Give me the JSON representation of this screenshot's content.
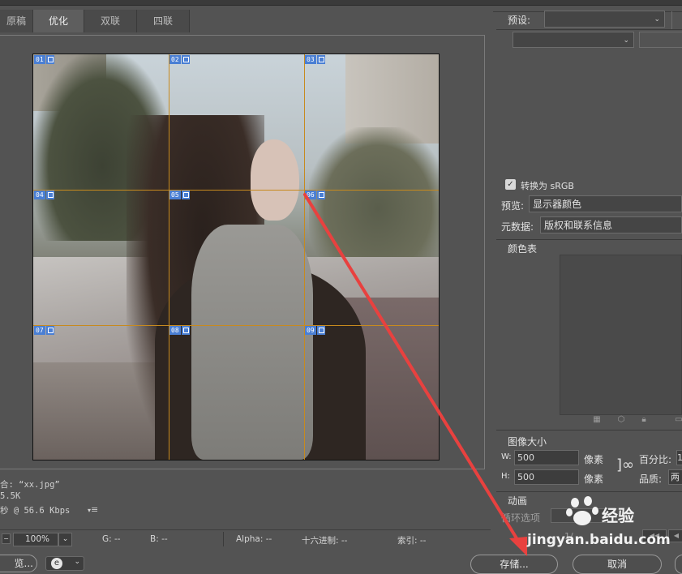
{
  "tabs": [
    "原稿",
    "优化",
    "双联",
    "四联"
  ],
  "active_tab": "优化",
  "slices": [
    "01",
    "02",
    "03",
    "04",
    "05",
    "06",
    "07",
    "08",
    "09"
  ],
  "info": {
    "format_line": "合: “xx.jpg”",
    "size_line": "5.5K",
    "time_line": "秒 @ 56.6 Kbps",
    "menu_icon": "≡"
  },
  "status": {
    "zoom": "100%",
    "g": "G: --",
    "b": "B: --",
    "alpha": "Alpha: --",
    "hex": "十六进制: --",
    "index": "索引: --"
  },
  "bottom": {
    "preview_btn": "览...",
    "save_btn": "存储...",
    "cancel_btn": "取消"
  },
  "panel": {
    "preset_label": "预设:",
    "preset_value": "",
    "format_value": "",
    "convert_srgb_label": "转换为 sRGB",
    "convert_srgb_checked": true,
    "preview_label": "预览:",
    "preview_value": "显示器颜色",
    "metadata_label": "元数据:",
    "metadata_value": "版权和联系信息",
    "color_table_label": "颜色表",
    "image_size_label": "图像大小",
    "w_label": "W:",
    "w_value": "500",
    "h_label": "H:",
    "h_value": "500",
    "unit": "像素",
    "percent_label": "百分比:",
    "percent_value": "1",
    "quality_label": "品质:",
    "quality_value": "两",
    "animation_label": "动画",
    "loop_label": "循环选项",
    "frame_counter": "1/"
  },
  "watermark": {
    "text1": "经验",
    "text2": "jingyan.baidu.com"
  },
  "colors": {
    "bg": "#535353",
    "grid": "#c78a1e",
    "slice_badge": "#4a7fd4",
    "arrow": "#e8413f"
  }
}
